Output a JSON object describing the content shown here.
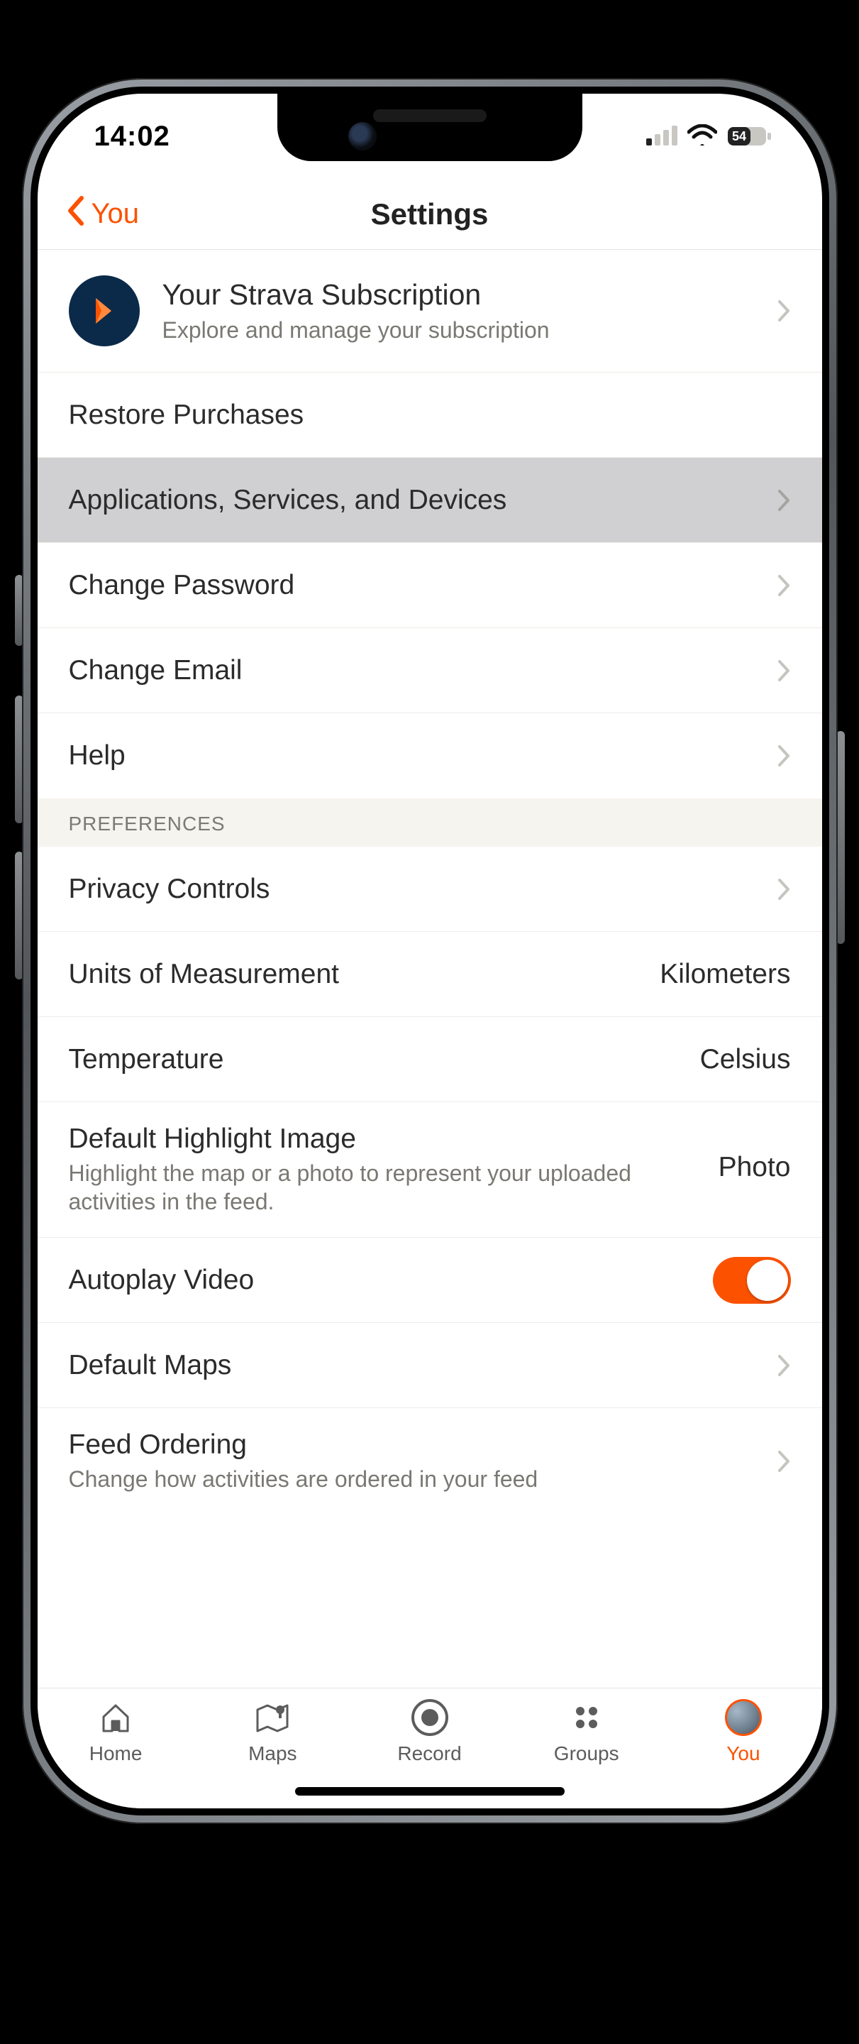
{
  "status": {
    "time": "14:02",
    "battery": "54"
  },
  "header": {
    "back_label": "You",
    "title": "Settings"
  },
  "rows": {
    "subscription": {
      "title": "Your Strava Subscription",
      "subtitle": "Explore and manage your subscription"
    },
    "restore": {
      "title": "Restore Purchases"
    },
    "apps": {
      "title": "Applications, Services, and Devices"
    },
    "password": {
      "title": "Change Password"
    },
    "email": {
      "title": "Change Email"
    },
    "help": {
      "title": "Help"
    },
    "section_preferences": "PREFERENCES",
    "privacy": {
      "title": "Privacy Controls"
    },
    "units": {
      "title": "Units of Measurement",
      "value": "Kilometers"
    },
    "temperature": {
      "title": "Temperature",
      "value": "Celsius"
    },
    "highlight": {
      "title": "Default Highlight Image",
      "subtitle": "Highlight the map or a photo to represent your uploaded activities in the feed.",
      "value": "Photo"
    },
    "autoplay": {
      "title": "Autoplay Video",
      "on": true
    },
    "default_maps": {
      "title": "Default Maps"
    },
    "feed_ordering": {
      "title": "Feed Ordering",
      "subtitle": "Change how activities are ordered in your feed"
    }
  },
  "tabs": {
    "home": "Home",
    "maps": "Maps",
    "record": "Record",
    "groups": "Groups",
    "you": "You"
  }
}
